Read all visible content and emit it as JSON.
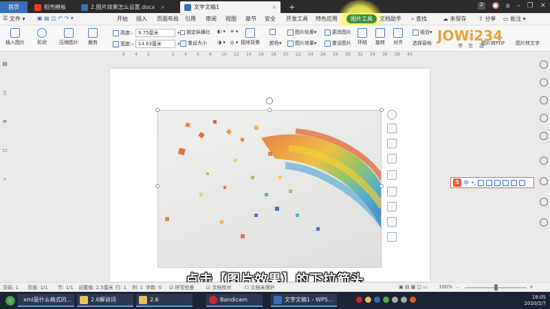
{
  "tabs": {
    "home": "首页",
    "template": "稻壳模板",
    "doc1": "2.图片效果怎么设置.docx",
    "doc2": "文字文稿1",
    "add": "+",
    "window_count": "2",
    "avatar_letter": "a"
  },
  "menu": {
    "file": "文件",
    "items": [
      "开始",
      "插入",
      "页面布局",
      "引用",
      "审阅",
      "视图",
      "章节",
      "安全",
      "开发工具",
      "特色应用"
    ],
    "picture_tools": "图片工具",
    "doc_helper": "文档助手",
    "search": "查找",
    "unsync": "未保存",
    "share": "分享",
    "comment": "批注"
  },
  "ribbon": {
    "insert_picture": "插入图片",
    "shape": "形状",
    "compress": "压缩图片",
    "crop": "裁剪",
    "height_label": "高度:",
    "height_value": "9.75厘米",
    "width_label": "宽度:",
    "width_value": "14.63厘米",
    "lock_ratio": "锁定纵横比",
    "reset_size": "重设大小",
    "cutout": "抠除背景",
    "color": "颜色",
    "picture_outline": "图片轮廓",
    "picture_effect": "图片效果",
    "change_picture": "更改图片",
    "reset_picture": "重设图片",
    "wrap": "环绕",
    "rotate": "旋转",
    "align": "对齐",
    "group": "组合",
    "select_pane": "选择窗格",
    "pdf_text": "图片转PDF",
    "pic_to_text": "图片转文字"
  },
  "ruler": [
    "6",
    "4",
    "2",
    "2",
    "4",
    "6",
    "8",
    "10",
    "12",
    "14",
    "16",
    "18",
    "20",
    "22",
    "24",
    "26",
    "28",
    "30",
    "32",
    "34",
    "36",
    "38",
    "40"
  ],
  "caption": "点击【图片效果】的下拉箭头",
  "ime": {
    "logo": "S",
    "mode": "中",
    "punct": "•,"
  },
  "status": {
    "page": "页码: 1",
    "pages": "页面: 1/1",
    "section": "节: 1/1",
    "setting": "设置值: 2.5厘米",
    "row": "行: 1",
    "col": "列: 1",
    "words": "字数: 0",
    "spell": "拼写检查",
    "proof": "文档校对",
    "unprotected": "文档未保护",
    "zoom": "100%"
  },
  "taskbar": {
    "t1": "xml是什么格式的...",
    "t2": "2.6解说词",
    "t3": "2.6",
    "t4": "Bandicam",
    "t5": "文字文稿1 - WPS...",
    "time": "18:05",
    "date": "2020/2/7"
  },
  "logo_text": "JOWi234",
  "logo_sub": "学 生 活",
  "colors": {
    "accent": "#3a8c3e",
    "tab_dark": "#2b2b2b",
    "highlight": "#fff550",
    "wps_blue": "#3a6fb6"
  }
}
